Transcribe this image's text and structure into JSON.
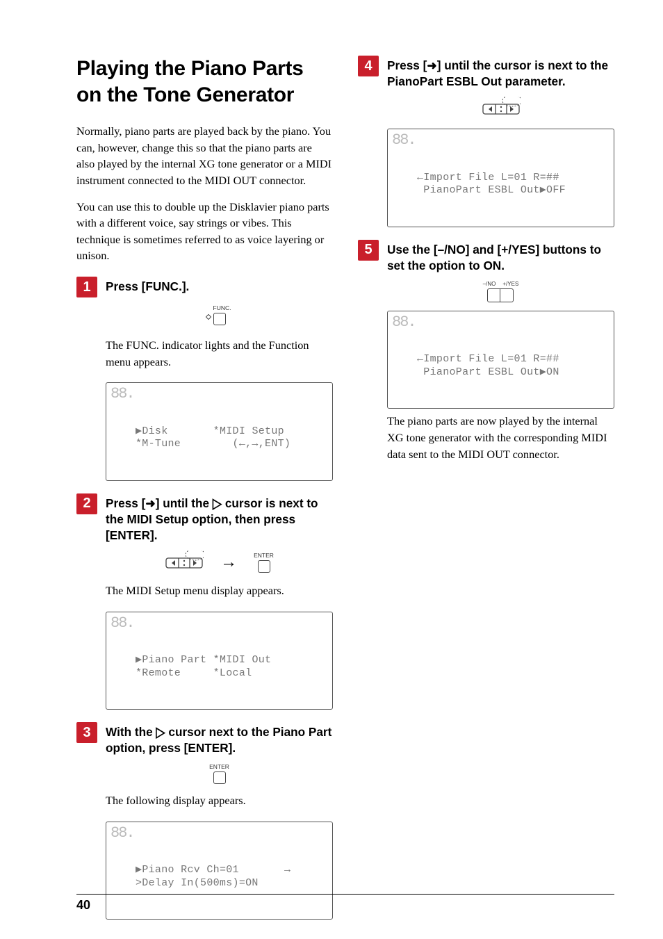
{
  "title": "Playing the Piano Parts on the Tone Generator",
  "intro1": "Normally, piano parts are played back by the piano. You can, however, change this so that the piano parts are also played by the internal XG tone generator or a MIDI instrument connected to the MIDI OUT connector.",
  "intro2": "You can use this to double up the Disklavier piano parts with a different voice, say strings or vibes. This technique is sometimes referred to as voice layering or unison.",
  "step1": {
    "num": "1",
    "text": "Press [FUNC.].",
    "btnLabel": "FUNC.",
    "result": "The FUNC. indicator lights and the Function menu appears.",
    "lcd1": "▶Disk       *MIDI Setup",
    "lcd2": "*M-Tune        (←,→,ENT)"
  },
  "step2": {
    "num": "2",
    "text": "Press [➜] until the ▷ cursor is next to the MIDI Setup option, then press [ENTER].",
    "enterLabel": "ENTER",
    "result": "The MIDI Setup menu display appears.",
    "lcd1": "▶Piano Part *MIDI Out",
    "lcd2": "*Remote     *Local"
  },
  "step3": {
    "num": "3",
    "text": "With the ▷ cursor next to the Piano Part option, press [ENTER].",
    "enterLabel": "ENTER",
    "result": "The following display appears.",
    "lcd1": "▶Piano Rcv Ch=01       →",
    "lcd2": ">Delay In(500ms)=ON"
  },
  "step4": {
    "num": "4",
    "text": "Press [➜] until the cursor is next to the PianoPart ESBL Out parameter.",
    "lcd1": "←Import File L=01 R=##",
    "lcd2": " PianoPart ESBL Out▶OFF"
  },
  "step5": {
    "num": "5",
    "text": "Use the [–/NO] and [+/YES] buttons to set the option to ON.",
    "minus": "–/NO",
    "plus": "+/YES",
    "lcd1": "←Import File L=01 R=##",
    "lcd2": " PianoPart ESBL Out▶ON",
    "result": "The piano parts are now played by the internal XG tone generator with the corresponding MIDI data sent to the MIDI OUT connector."
  },
  "pageNum": "40"
}
